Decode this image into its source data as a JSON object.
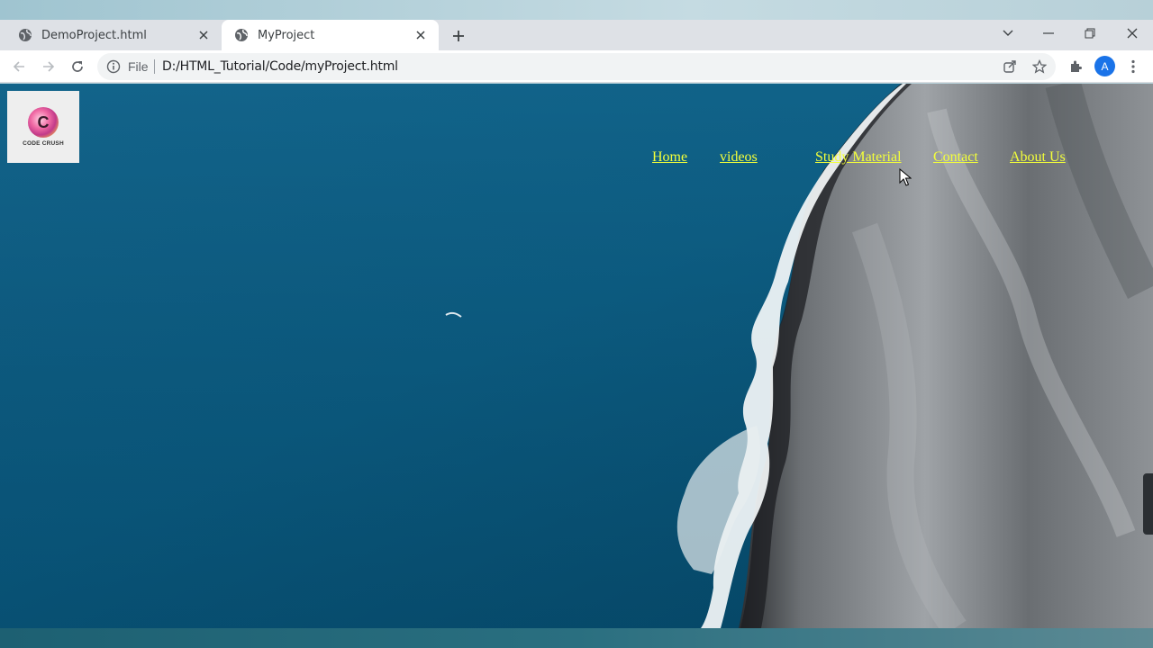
{
  "browser": {
    "tabs": [
      {
        "title": "DemoProject.html",
        "active": false
      },
      {
        "title": "MyProject",
        "active": true
      }
    ],
    "address": {
      "scheme_label": "File",
      "url": "D:/HTML_Tutorial/Code/myProject.html"
    },
    "profile_initial": "A"
  },
  "page": {
    "logo": {
      "mark": "C",
      "text": "CODE CRUSH"
    },
    "nav": [
      {
        "label": "Home"
      },
      {
        "label": "videos"
      },
      {
        "label": "Study Material"
      },
      {
        "label": "Contact"
      },
      {
        "label": "About Us"
      }
    ],
    "nav_link_color": "#f3ff3a",
    "hovered_link": "Study Material"
  },
  "icons": [
    "globe-icon",
    "close-icon",
    "new-tab-icon",
    "tab-search-icon",
    "minimize-icon",
    "restore-icon",
    "window-close-icon",
    "back-icon",
    "forward-icon",
    "reload-icon",
    "info-icon",
    "share-icon",
    "bookmark-star-icon",
    "extensions-icon",
    "menu-icon"
  ]
}
